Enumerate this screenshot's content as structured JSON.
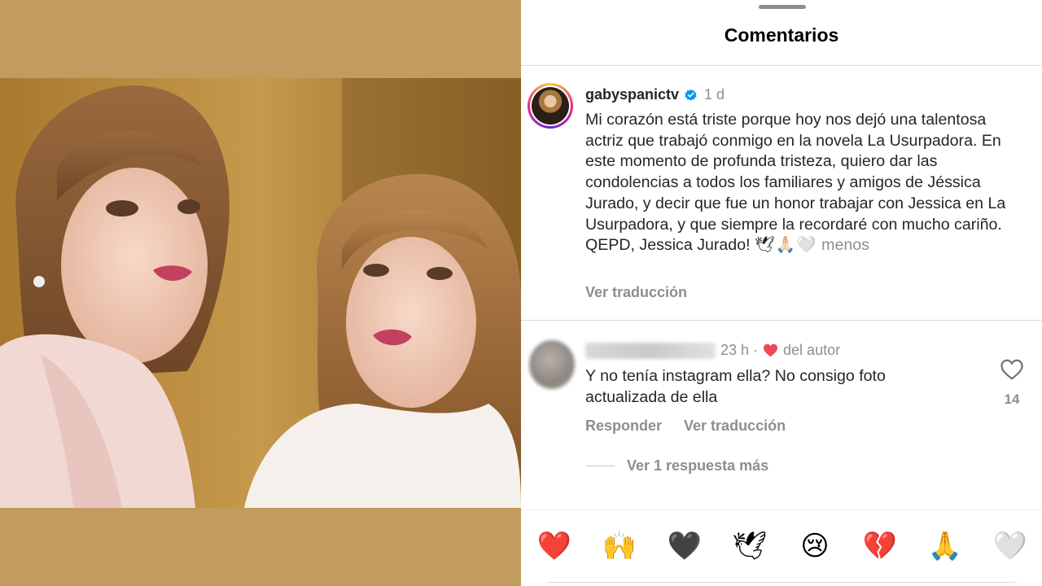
{
  "sheet": {
    "title": "Comentarios"
  },
  "post": {
    "username": "gabyspanictv",
    "verified": true,
    "time": "1 d",
    "caption": "Mi corazón está triste porque hoy nos dejó una talentosa actriz que trabajó conmigo en la novela La Usurpadora. En este momento de profunda tristeza, quiero dar las condolencias a todos los familiares y amigos de Jéssica Jurado, y decir que fue un honor trabajar con Jessica en La Usurpadora, y que siempre la recordaré con mucho cariño. QEPD, Jessica Jurado!",
    "caption_emojis": "🕊🙏🏻🤍",
    "less_label": "menos",
    "see_translation": "Ver traducción"
  },
  "comment": {
    "time": "23 h ·",
    "author_liked_label": "del autor",
    "text": "Y no tenía instagram ella?  No consigo foto actualizada de ella",
    "like_count": "14",
    "reply_label": "Responder",
    "translate_label": "Ver traducción",
    "more_replies_label": "Ver 1 respuesta más"
  },
  "emoji_bar": [
    "❤️",
    "🙌",
    "🖤",
    "🕊",
    "😢",
    "💔",
    "🙏",
    "🤍"
  ],
  "colors": {
    "photo_background": "#c29b5e",
    "secondary_text": "#8e8e8e",
    "verified_blue": "#0095f6",
    "heart_red": "#ed4956"
  }
}
